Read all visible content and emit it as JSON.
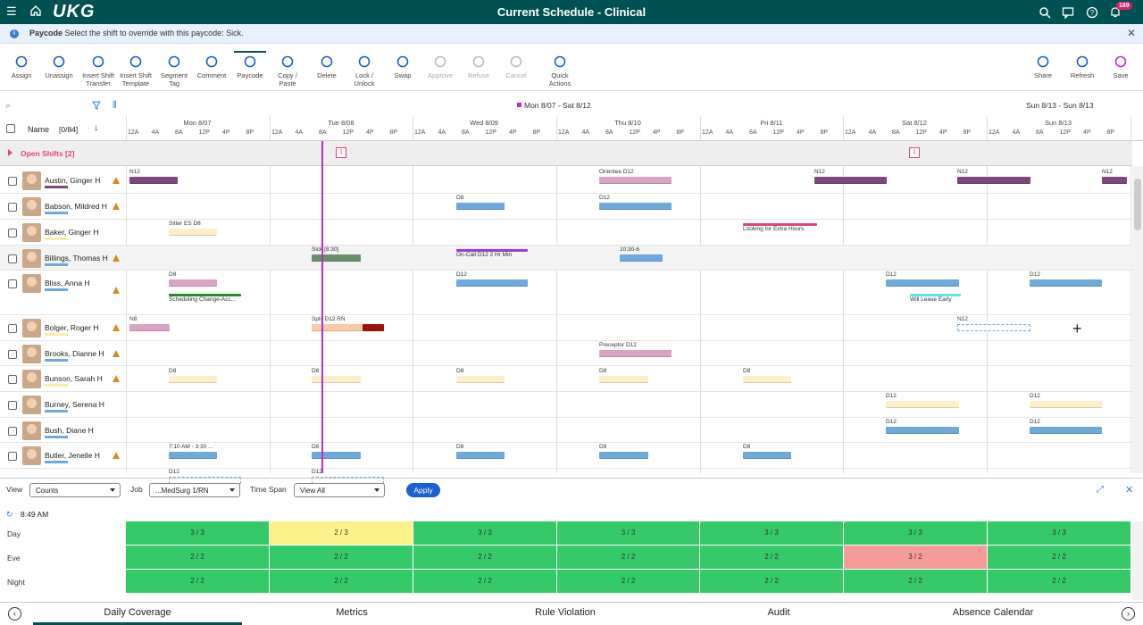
{
  "header": {
    "logo": "UKG",
    "title": "Current Schedule - Clinical",
    "notif_count": "189"
  },
  "message": {
    "bold": "Paycode",
    "text": "Select the shift to override with this paycode: Sick."
  },
  "toolbar": [
    {
      "label": "Assign",
      "icon": "assign-icon"
    },
    {
      "label": "Unassign",
      "icon": "unassign-icon"
    },
    {
      "label": "Insert Shift Transfer",
      "icon": "transfer-icon"
    },
    {
      "label": "Insert Shift Template",
      "icon": "template-icon"
    },
    {
      "label": "Segment Tag",
      "icon": "tag-icon"
    },
    {
      "label": "Comment",
      "icon": "comment-icon"
    },
    {
      "label": "Paycode",
      "icon": "paycode-icon"
    },
    {
      "label": "Copy / Paste",
      "icon": "copy-icon"
    },
    {
      "label": "Delete",
      "icon": "delete-icon"
    },
    {
      "label": "Lock / Unlock",
      "icon": "lock-icon"
    },
    {
      "label": "Swap",
      "icon": "swap-icon"
    },
    {
      "label": "Approve",
      "icon": "check-icon"
    },
    {
      "label": "Refuse",
      "icon": "x-icon"
    },
    {
      "label": "Cancel",
      "icon": "cancel-icon"
    },
    {
      "label": "Quick Actions",
      "icon": "lightning-icon"
    },
    {
      "label": "Share",
      "icon": "share-icon"
    },
    {
      "label": "Refresh",
      "icon": "refresh-icon"
    },
    {
      "label": "Save",
      "icon": "save-icon"
    }
  ],
  "grid": {
    "name_header": "Name",
    "count": "[0/84]",
    "week1": "Mon 8/07 - Sat 8/12",
    "week2": "Sun 8/13 - Sun 8/13",
    "days": [
      "Mon 8/07",
      "Tue 8/08",
      "Wed 8/09",
      "Thu 8/10",
      "Fri 8/11",
      "Sat 8/12",
      "Sun 8/13"
    ],
    "hours": [
      "12A",
      "4A",
      "8A",
      "12P",
      "4P",
      "8P"
    ],
    "open_shifts": "Open Shifts [2]",
    "open_count": "1"
  },
  "employees": [
    {
      "name": "Austin, Ginger H",
      "warn": true
    },
    {
      "name": "Babson, Mildred H",
      "warn": true
    },
    {
      "name": "Baker, Ginger H",
      "warn": false
    },
    {
      "name": "Billings, Thomas H",
      "warn": true
    },
    {
      "name": "Bliss, Anna H",
      "warn": true
    },
    {
      "name": "Bolger, Roger H",
      "warn": true
    },
    {
      "name": "Brooks, Dianne H",
      "warn": true
    },
    {
      "name": "Bunson, Sarah H",
      "warn": true
    },
    {
      "name": "Burney, Serena H",
      "warn": false
    },
    {
      "name": "Bush, Diane H",
      "warn": false
    },
    {
      "name": "Butler, Jenelle H",
      "warn": true
    }
  ],
  "shift_labels": {
    "a1": "N12",
    "a2": "Orientee D12",
    "a3": "N12",
    "a4": "N12",
    "a5": "N12",
    "b1": "D8",
    "b2": "D12",
    "c1": "Sitter ES D8",
    "c2": "Looking for Extra Hours",
    "d1": "Sick [8:30]",
    "d2": "On-Call D12 2 Hr Min",
    "d3": "10:30-6",
    "e1": "D8",
    "e2": "Scheduling Change-Acc...",
    "e3": "D12",
    "e4": "D12",
    "e5": "Will Leave Early",
    "e6": "D12",
    "f1": "N8",
    "f2": "Split D12 RN",
    "f3": "N12",
    "g1": "Preceptor D12",
    "h1": "D8",
    "h2": "D8",
    "h3": "D8",
    "h4": "D8",
    "h5": "D8",
    "i1": "D12",
    "i2": "D12",
    "j1": "D12",
    "j2": "D12",
    "k1": "7:10 AM - 3:30 ...",
    "k2": "D8",
    "k3": "D8",
    "k4": "D8",
    "k5": "D8",
    "l1": "D12",
    "l2": "D12"
  },
  "controls": {
    "view_label": "View",
    "view_value": "Counts",
    "job_label": "Job",
    "job_value": "...MedSurg 1/RN",
    "span_label": "Time Span",
    "span_value": "View All",
    "apply": "Apply",
    "time": "8:49 AM"
  },
  "coverage": [
    {
      "label": "Day",
      "cells": [
        "3 / 3",
        "2 / 3",
        "3 / 3",
        "3 / 3",
        "3 / 3",
        "3 / 3",
        "3 / 3"
      ]
    },
    {
      "label": "Eve",
      "cells": [
        "2 / 2",
        "2 / 2",
        "2 / 2",
        "2 / 2",
        "2 / 2",
        "3 / 2",
        "2 / 2"
      ]
    },
    {
      "label": "Night",
      "cells": [
        "2 / 2",
        "2 / 2",
        "2 / 2",
        "2 / 2",
        "2 / 2",
        "2 / 2",
        "2 / 2"
      ]
    }
  ],
  "tabs": [
    "Daily Coverage",
    "Metrics",
    "Rule Violation",
    "Audit",
    "Absence Calendar"
  ],
  "colors": {
    "green": "#35c96a",
    "yellow": "#fbf38a",
    "red": "#f79a9a",
    "teal": "#005151"
  }
}
